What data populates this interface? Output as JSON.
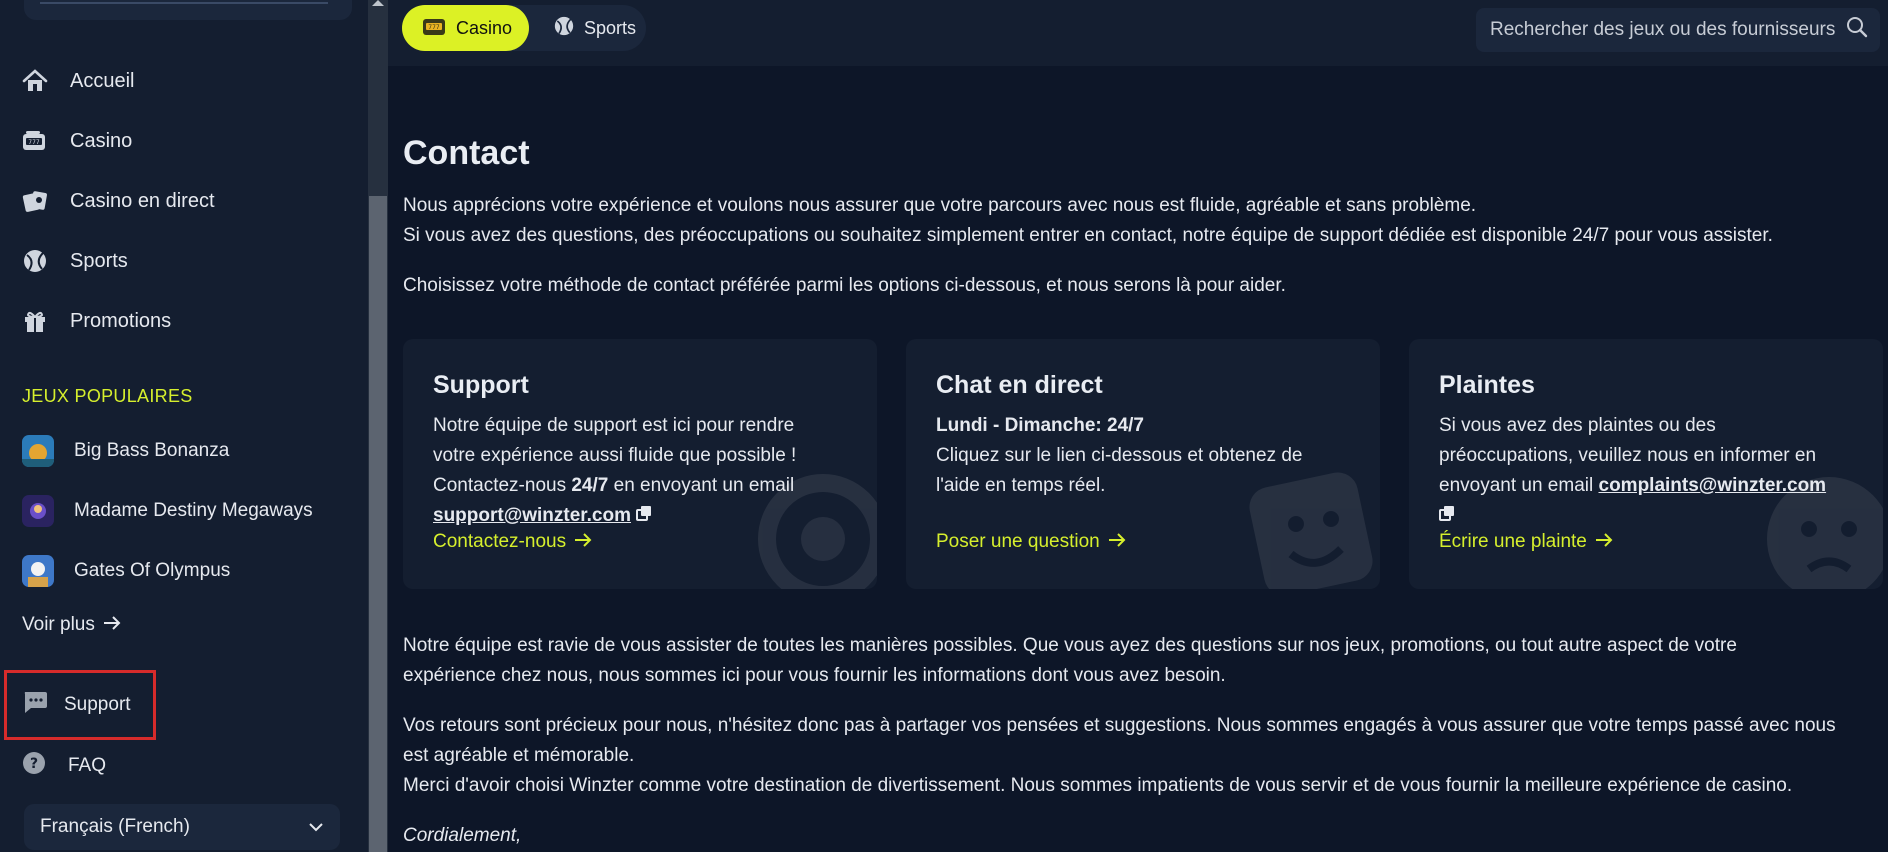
{
  "sidebar": {
    "nav": [
      {
        "label": "Accueil",
        "icon": "home-icon"
      },
      {
        "label": "Casino",
        "icon": "slot-machine-icon"
      },
      {
        "label": "Casino en direct",
        "icon": "cards-icon"
      },
      {
        "label": "Sports",
        "icon": "ball-icon"
      },
      {
        "label": "Promotions",
        "icon": "gift-icon"
      }
    ],
    "popular_title": "JEUX POPULAIRES",
    "games": [
      {
        "label": "Big Bass Bonanza"
      },
      {
        "label": "Madame Destiny Megaways"
      },
      {
        "label": "Gates Of Olympus"
      }
    ],
    "more_label": "Voir plus",
    "support_label": "Support",
    "faq_label": "FAQ",
    "language": "Français (French)"
  },
  "topbar": {
    "tabs": [
      {
        "label": "Casino",
        "active": true
      },
      {
        "label": "Sports",
        "active": false
      }
    ],
    "search_placeholder": "Rechercher des jeux ou des fournisseurs"
  },
  "page": {
    "title": "Contact",
    "intro_1": "Nous apprécions votre expérience et voulons nous assurer que votre parcours avec nous est fluide, agréable et sans problème.",
    "intro_2": "Si vous avez des questions, des préoccupations ou souhaitez simplement entrer en contact, notre équipe de support dédiée est disponible 24/7 pour vous assister.",
    "intro_3": "Choisissez votre méthode de contact préférée parmi les options ci-dessous, et nous serons là pour aider.",
    "cards": {
      "support": {
        "title": "Support",
        "line1": "Notre équipe de support est ici pour rendre",
        "line2": "votre expérience aussi fluide que possible !",
        "line3a": "Contactez-nous ",
        "line3b": "24/7",
        "line3c": " en envoyant un email",
        "email": "support@winzter.com",
        "link": "Contactez-nous"
      },
      "chat": {
        "title": "Chat en direct",
        "hours": "Lundi - Dimanche: 24/7",
        "line1": "Cliquez sur le lien ci-dessous et obtenez de",
        "line2": "l'aide en temps réel.",
        "link": "Poser une question"
      },
      "complaints": {
        "title": "Plaintes",
        "line1": "Si vous avez des plaintes ou des",
        "line2": "préoccupations, veuillez nous en informer en",
        "line3": "envoyant un email ",
        "email": "complaints@winzter.com",
        "link": "Écrire une plainte"
      }
    },
    "para_1a": "Notre équipe est ravie de vous assister de toutes les manières possibles. Que vous ayez des questions sur nos jeux, promotions, ou tout autre aspect de votre",
    "para_1b": "expérience chez nous, nous sommes ici pour vous fournir les informations dont vous avez besoin.",
    "para_2a": "Vos retours sont précieux pour nous, n'hésitez donc pas à partager vos pensées et suggestions. Nous sommes engagés à vous assurer que votre temps passé avec nous",
    "para_2b": "est agréable et mémorable.",
    "para_2c": "Merci d'avoir choisi Winzter comme votre destination de divertissement. Nous sommes impatients de vous servir et de vous fournir la meilleure expérience de casino.",
    "closing": "Cordialement,"
  },
  "colors": {
    "accent": "#d6ef2d",
    "background": "#0d1628",
    "panel": "#141e30",
    "highlight_box": "#d62b2b"
  }
}
